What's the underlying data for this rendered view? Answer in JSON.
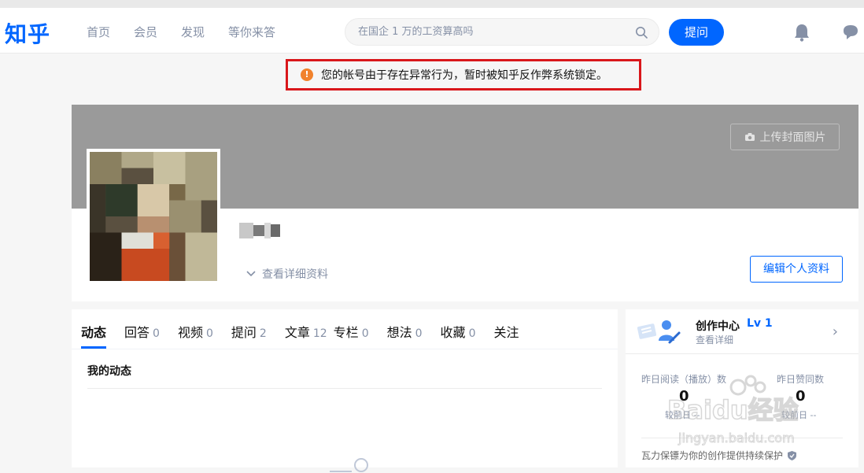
{
  "header": {
    "logo": "知乎",
    "nav": [
      "首页",
      "会员",
      "发现",
      "等你来答"
    ],
    "search_placeholder": "在国企 1 万的工资算高吗",
    "ask_label": "提问"
  },
  "notice": {
    "text": "您的帐号由于存在异常行为，暂时被知乎反作弊系统锁定。",
    "icon": "warning-icon",
    "border_color": "#d9171b"
  },
  "profile": {
    "upload_cover_label": "上传封面图片",
    "view_details_label": "查看详细资料",
    "edit_profile_label": "编辑个人资料"
  },
  "tabs": [
    {
      "label": "动态",
      "count": ""
    },
    {
      "label": "回答",
      "count": "0"
    },
    {
      "label": "视频",
      "count": "0"
    },
    {
      "label": "提问",
      "count": "2"
    },
    {
      "label": "文章",
      "count": "12"
    },
    {
      "label": "专栏",
      "count": "0"
    },
    {
      "label": "想法",
      "count": "0"
    },
    {
      "label": "收藏",
      "count": "0"
    },
    {
      "label": "关注",
      "count": ""
    }
  ],
  "feed": {
    "section_title": "我的动态"
  },
  "creator": {
    "title": "创作中心",
    "level": "Lv 1",
    "subtitle": "查看详细",
    "stats": [
      {
        "label": "昨日阅读（播放）数",
        "value": "0",
        "compare": "较前日 --"
      },
      {
        "label": "昨日赞同数",
        "value": "0",
        "compare": "较前日 --"
      }
    ],
    "footer": "瓦力保镖为你的创作提供持续保护"
  },
  "watermark": {
    "text": "Baidu经验",
    "sub": "jingyan.baidu.com"
  },
  "colors": {
    "brand": "#0066ff",
    "cover": "#9a9a9a",
    "warning": "#f1822c"
  }
}
